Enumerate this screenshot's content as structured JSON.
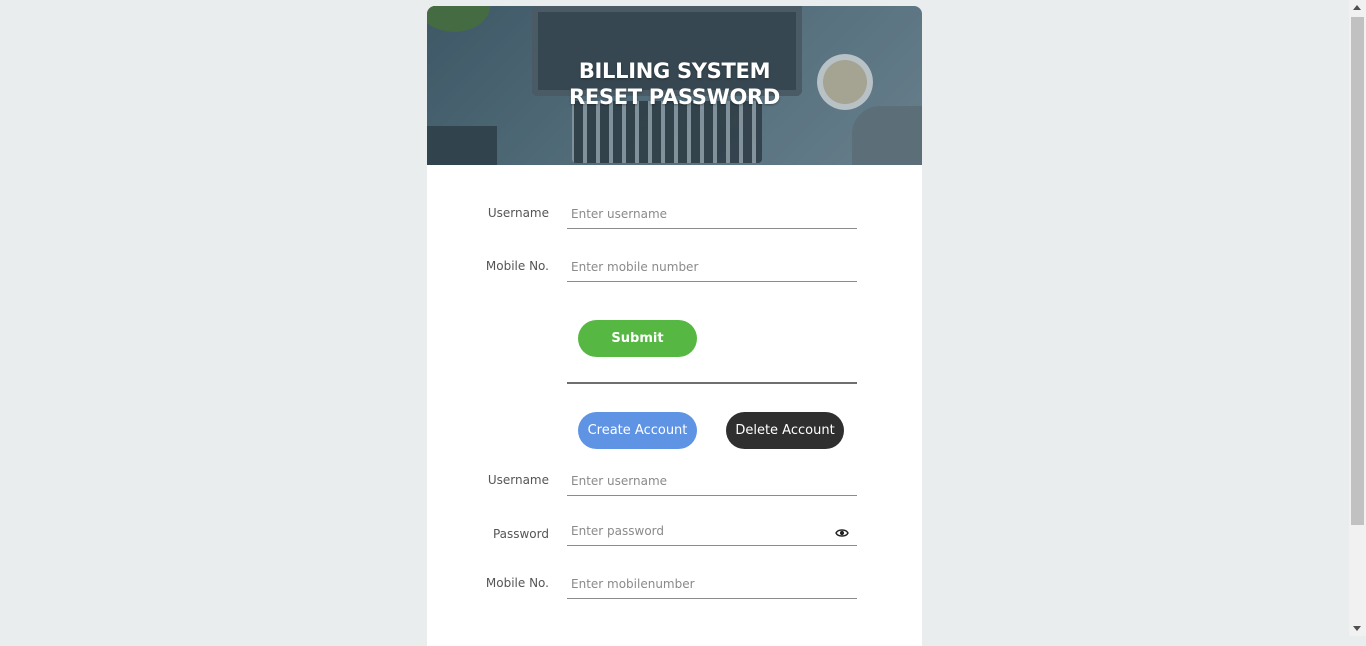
{
  "header": {
    "title_line1": "BILLING SYSTEM",
    "title_line2": "RESET PASSWORD"
  },
  "reset_form": {
    "username_label": "Username",
    "username_placeholder": "Enter username",
    "mobile_label": "Mobile No.",
    "mobile_placeholder": "Enter mobile number",
    "submit_label": "Submit"
  },
  "account_actions": {
    "create_label": "Create Account",
    "delete_label": "Delete Account"
  },
  "account_form": {
    "username_label": "Username",
    "username_placeholder": "Enter username",
    "password_label": "Password",
    "password_placeholder": "Enter password",
    "password_toggle_icon": "eye-icon",
    "mobile_label": "Mobile No.",
    "mobile_placeholder": "Enter mobilenumber"
  },
  "colors": {
    "submit": "#56b743",
    "create": "#5f93e4",
    "delete": "#2f2f2f",
    "background": "#e9edee"
  }
}
